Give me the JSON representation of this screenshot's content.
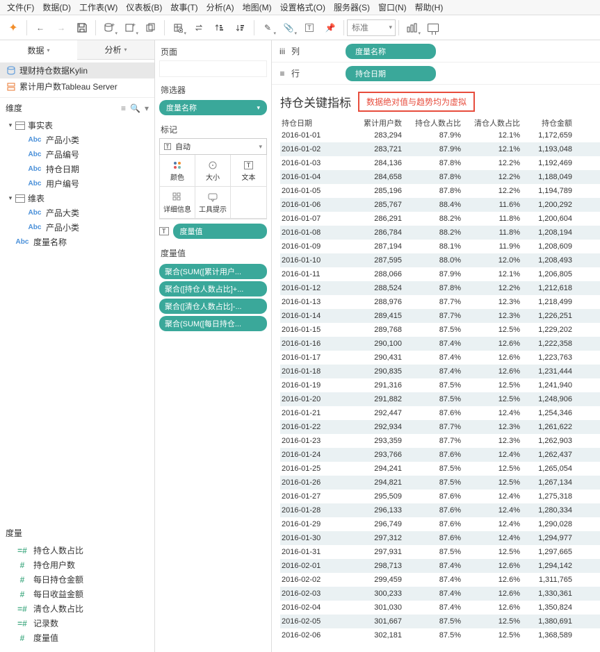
{
  "menu": [
    "文件(F)",
    "数据(D)",
    "工作表(W)",
    "仪表板(B)",
    "故事(T)",
    "分析(A)",
    "地图(M)",
    "设置格式(O)",
    "服务器(S)",
    "窗口(N)",
    "帮助(H)"
  ],
  "toolbar": {
    "fit": "标准"
  },
  "left": {
    "tabs": [
      "数据",
      "分析"
    ],
    "datasources": [
      "理财持仓数据Kylin",
      "累计用户数Tableau Server"
    ],
    "dim_header": "维度",
    "fact_table": "事实表",
    "fact_fields": [
      "产品小类",
      "产品编号",
      "持仓日期",
      "用户编号"
    ],
    "dim_table": "维表",
    "dim_fields": [
      "产品大类",
      "产品小类"
    ],
    "extra_field": "度量名称",
    "measure_header": "度量",
    "measures": [
      "持仓人数占比",
      "持仓用户数",
      "每日持仓金额",
      "每日收益金额",
      "清仓人数占比",
      "记录数",
      "度量值"
    ]
  },
  "mid": {
    "pages": "页面",
    "filters": "筛选器",
    "filter_pill": "度量名称",
    "marks": "标记",
    "marks_type": "自动",
    "mark_items": [
      "颜色",
      "大小",
      "文本",
      "详细信息",
      "工具提示"
    ],
    "mark_pill": "度量值",
    "mv_header": "度量值",
    "mv_items": [
      "聚合(SUM([累计用户...",
      "聚合([持仓人数占比]+...",
      "聚合([清仓人数占比]-...",
      "聚合(SUM([每日持仓..."
    ]
  },
  "shelves": {
    "cols_label": "列",
    "cols_pill": "度量名称",
    "rows_label": "行",
    "rows_pill": "持仓日期"
  },
  "viz": {
    "title": "持仓关键指标",
    "note": "数据绝对值与趋势均为虚拟",
    "headers": [
      "持仓日期",
      "累计用户数",
      "持仓人数占比",
      "清仓人数占比",
      "持仓金额"
    ]
  },
  "chart_data": {
    "type": "table",
    "columns": [
      "持仓日期",
      "累计用户数",
      "持仓人数占比",
      "清仓人数占比",
      "持仓金额"
    ],
    "rows": [
      [
        "2016-01-01",
        "283,294",
        "87.9%",
        "12.1%",
        "1,172,659"
      ],
      [
        "2016-01-02",
        "283,721",
        "87.9%",
        "12.1%",
        "1,193,048"
      ],
      [
        "2016-01-03",
        "284,136",
        "87.8%",
        "12.2%",
        "1,192,469"
      ],
      [
        "2016-01-04",
        "284,658",
        "87.8%",
        "12.2%",
        "1,188,049"
      ],
      [
        "2016-01-05",
        "285,196",
        "87.8%",
        "12.2%",
        "1,194,789"
      ],
      [
        "2016-01-06",
        "285,767",
        "88.4%",
        "11.6%",
        "1,200,292"
      ],
      [
        "2016-01-07",
        "286,291",
        "88.2%",
        "11.8%",
        "1,200,604"
      ],
      [
        "2016-01-08",
        "286,784",
        "88.2%",
        "11.8%",
        "1,208,194"
      ],
      [
        "2016-01-09",
        "287,194",
        "88.1%",
        "11.9%",
        "1,208,609"
      ],
      [
        "2016-01-10",
        "287,595",
        "88.0%",
        "12.0%",
        "1,208,493"
      ],
      [
        "2016-01-11",
        "288,066",
        "87.9%",
        "12.1%",
        "1,206,805"
      ],
      [
        "2016-01-12",
        "288,524",
        "87.8%",
        "12.2%",
        "1,212,618"
      ],
      [
        "2016-01-13",
        "288,976",
        "87.7%",
        "12.3%",
        "1,218,499"
      ],
      [
        "2016-01-14",
        "289,415",
        "87.7%",
        "12.3%",
        "1,226,251"
      ],
      [
        "2016-01-15",
        "289,768",
        "87.5%",
        "12.5%",
        "1,229,202"
      ],
      [
        "2016-01-16",
        "290,100",
        "87.4%",
        "12.6%",
        "1,222,358"
      ],
      [
        "2016-01-17",
        "290,431",
        "87.4%",
        "12.6%",
        "1,223,763"
      ],
      [
        "2016-01-18",
        "290,835",
        "87.4%",
        "12.6%",
        "1,231,444"
      ],
      [
        "2016-01-19",
        "291,316",
        "87.5%",
        "12.5%",
        "1,241,940"
      ],
      [
        "2016-01-20",
        "291,882",
        "87.5%",
        "12.5%",
        "1,248,906"
      ],
      [
        "2016-01-21",
        "292,447",
        "87.6%",
        "12.4%",
        "1,254,346"
      ],
      [
        "2016-01-22",
        "292,934",
        "87.7%",
        "12.3%",
        "1,261,622"
      ],
      [
        "2016-01-23",
        "293,359",
        "87.7%",
        "12.3%",
        "1,262,903"
      ],
      [
        "2016-01-24",
        "293,766",
        "87.6%",
        "12.4%",
        "1,262,437"
      ],
      [
        "2016-01-25",
        "294,241",
        "87.5%",
        "12.5%",
        "1,265,054"
      ],
      [
        "2016-01-26",
        "294,821",
        "87.5%",
        "12.5%",
        "1,267,134"
      ],
      [
        "2016-01-27",
        "295,509",
        "87.6%",
        "12.4%",
        "1,275,318"
      ],
      [
        "2016-01-28",
        "296,133",
        "87.6%",
        "12.4%",
        "1,280,334"
      ],
      [
        "2016-01-29",
        "296,749",
        "87.6%",
        "12.4%",
        "1,290,028"
      ],
      [
        "2016-01-30",
        "297,312",
        "87.6%",
        "12.4%",
        "1,294,977"
      ],
      [
        "2016-01-31",
        "297,931",
        "87.5%",
        "12.5%",
        "1,297,665"
      ],
      [
        "2016-02-01",
        "298,713",
        "87.4%",
        "12.6%",
        "1,294,142"
      ],
      [
        "2016-02-02",
        "299,459",
        "87.4%",
        "12.6%",
        "1,311,765"
      ],
      [
        "2016-02-03",
        "300,233",
        "87.4%",
        "12.6%",
        "1,330,361"
      ],
      [
        "2016-02-04",
        "301,030",
        "87.4%",
        "12.6%",
        "1,350,824"
      ],
      [
        "2016-02-05",
        "301,667",
        "87.5%",
        "12.5%",
        "1,380,691"
      ],
      [
        "2016-02-06",
        "302,181",
        "87.5%",
        "12.5%",
        "1,368,589"
      ]
    ]
  }
}
